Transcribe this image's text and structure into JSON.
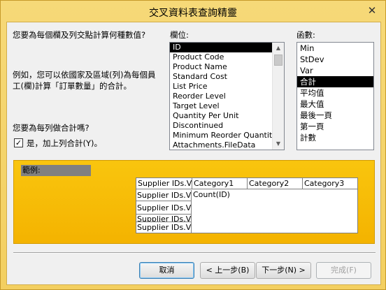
{
  "window": {
    "title": "交叉資料表查詢精靈",
    "close_glyph": "✕"
  },
  "left_panel": {
    "question": "您要為每個欄及列交點計算何種數值?",
    "example_line1": "例如，您可以依國家及區域(列)為每個員",
    "example_line2": "工(欄)計算「訂單數量」的合計。",
    "sum_question": "您要為每列做合計嗎?",
    "checkbox_checked": true,
    "checkbox_glyph": "✓",
    "checkbox_label": "是，加上列合計(Y)。"
  },
  "fields": {
    "label": "欄位:",
    "items": [
      "ID",
      "Product Code",
      "Product Name",
      "Standard Cost",
      "List Price",
      "Reorder Level",
      "Target Level",
      "Quantity Per Unit",
      "Discontinued",
      "Minimum Reorder Quantity",
      "Attachments.FileData"
    ],
    "selected": "ID"
  },
  "functions": {
    "label": "函數:",
    "items": [
      "Min",
      "StDev",
      "Var",
      "合計",
      "平均值",
      "最大值",
      "最後一頁",
      "第一頁",
      "計數"
    ],
    "selected": "合計"
  },
  "sample": {
    "label": "範例:",
    "headers": [
      "Supplier IDs.V",
      "Category1",
      "Category2",
      "Category3"
    ],
    "row_headers": [
      "Supplier IDs.Val",
      "Supplier IDs.Val",
      "Supplier IDs.Val",
      "Supplier IDs.Val"
    ],
    "cell": "Count(ID)"
  },
  "buttons": {
    "cancel": "取消",
    "back": "< 上一步(B)",
    "next": "下一步(N) >",
    "finish": "完成(F)"
  }
}
